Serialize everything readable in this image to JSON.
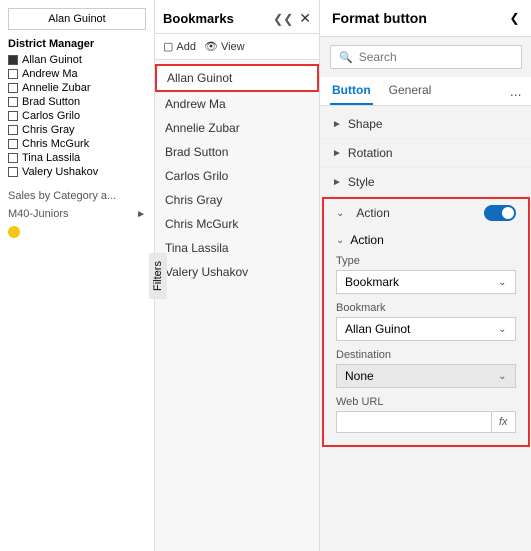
{
  "left": {
    "district_box": "Alan Guinot",
    "district_label": "District Manager",
    "items": [
      {
        "name": "Allan Guinot",
        "active": true
      },
      {
        "name": "Andrew Ma",
        "active": false
      },
      {
        "name": "Annelie Zubar",
        "active": false
      },
      {
        "name": "Brad Sutton",
        "active": false
      },
      {
        "name": "Carlos Grilo",
        "active": false
      },
      {
        "name": "Chris Gray",
        "active": false
      },
      {
        "name": "Chris McGurk",
        "active": false
      },
      {
        "name": "Tina Lassila",
        "active": false
      },
      {
        "name": "Valery Ushakov",
        "active": false
      }
    ],
    "sales_label": "Sales by Category a...",
    "m40_label": "M40-Juniors"
  },
  "bookmarks": {
    "title": "Bookmarks",
    "add_label": "Add",
    "view_label": "View",
    "items": [
      {
        "name": "Allan Guinot",
        "selected": true
      },
      {
        "name": "Andrew Ma"
      },
      {
        "name": "Annelie Zubar"
      },
      {
        "name": "Brad Sutton"
      },
      {
        "name": "Carlos Grilo"
      },
      {
        "name": "Chris Gray"
      },
      {
        "name": "Chris McGurk"
      },
      {
        "name": "Tina Lassila"
      },
      {
        "name": "Valery Ushakov"
      }
    ],
    "filters_label": "Filters"
  },
  "right": {
    "title": "Format button",
    "search_placeholder": "Search",
    "tabs": [
      {
        "label": "Button",
        "active": true
      },
      {
        "label": "General",
        "active": false
      }
    ],
    "tab_more": "...",
    "sections": [
      {
        "label": "Shape",
        "expanded": false
      },
      {
        "label": "Rotation",
        "expanded": false
      },
      {
        "label": "Style",
        "expanded": false
      }
    ],
    "action": {
      "label": "Action",
      "toggle_state": "On",
      "sub_label": "Action",
      "type_label": "Type",
      "type_value": "Bookmark",
      "bookmark_label": "Bookmark",
      "bookmark_value": "Allan Guinot",
      "destination_label": "Destination",
      "destination_value": "None",
      "weburl_label": "Web URL",
      "weburl_value": "",
      "fx_label": "fx"
    }
  }
}
